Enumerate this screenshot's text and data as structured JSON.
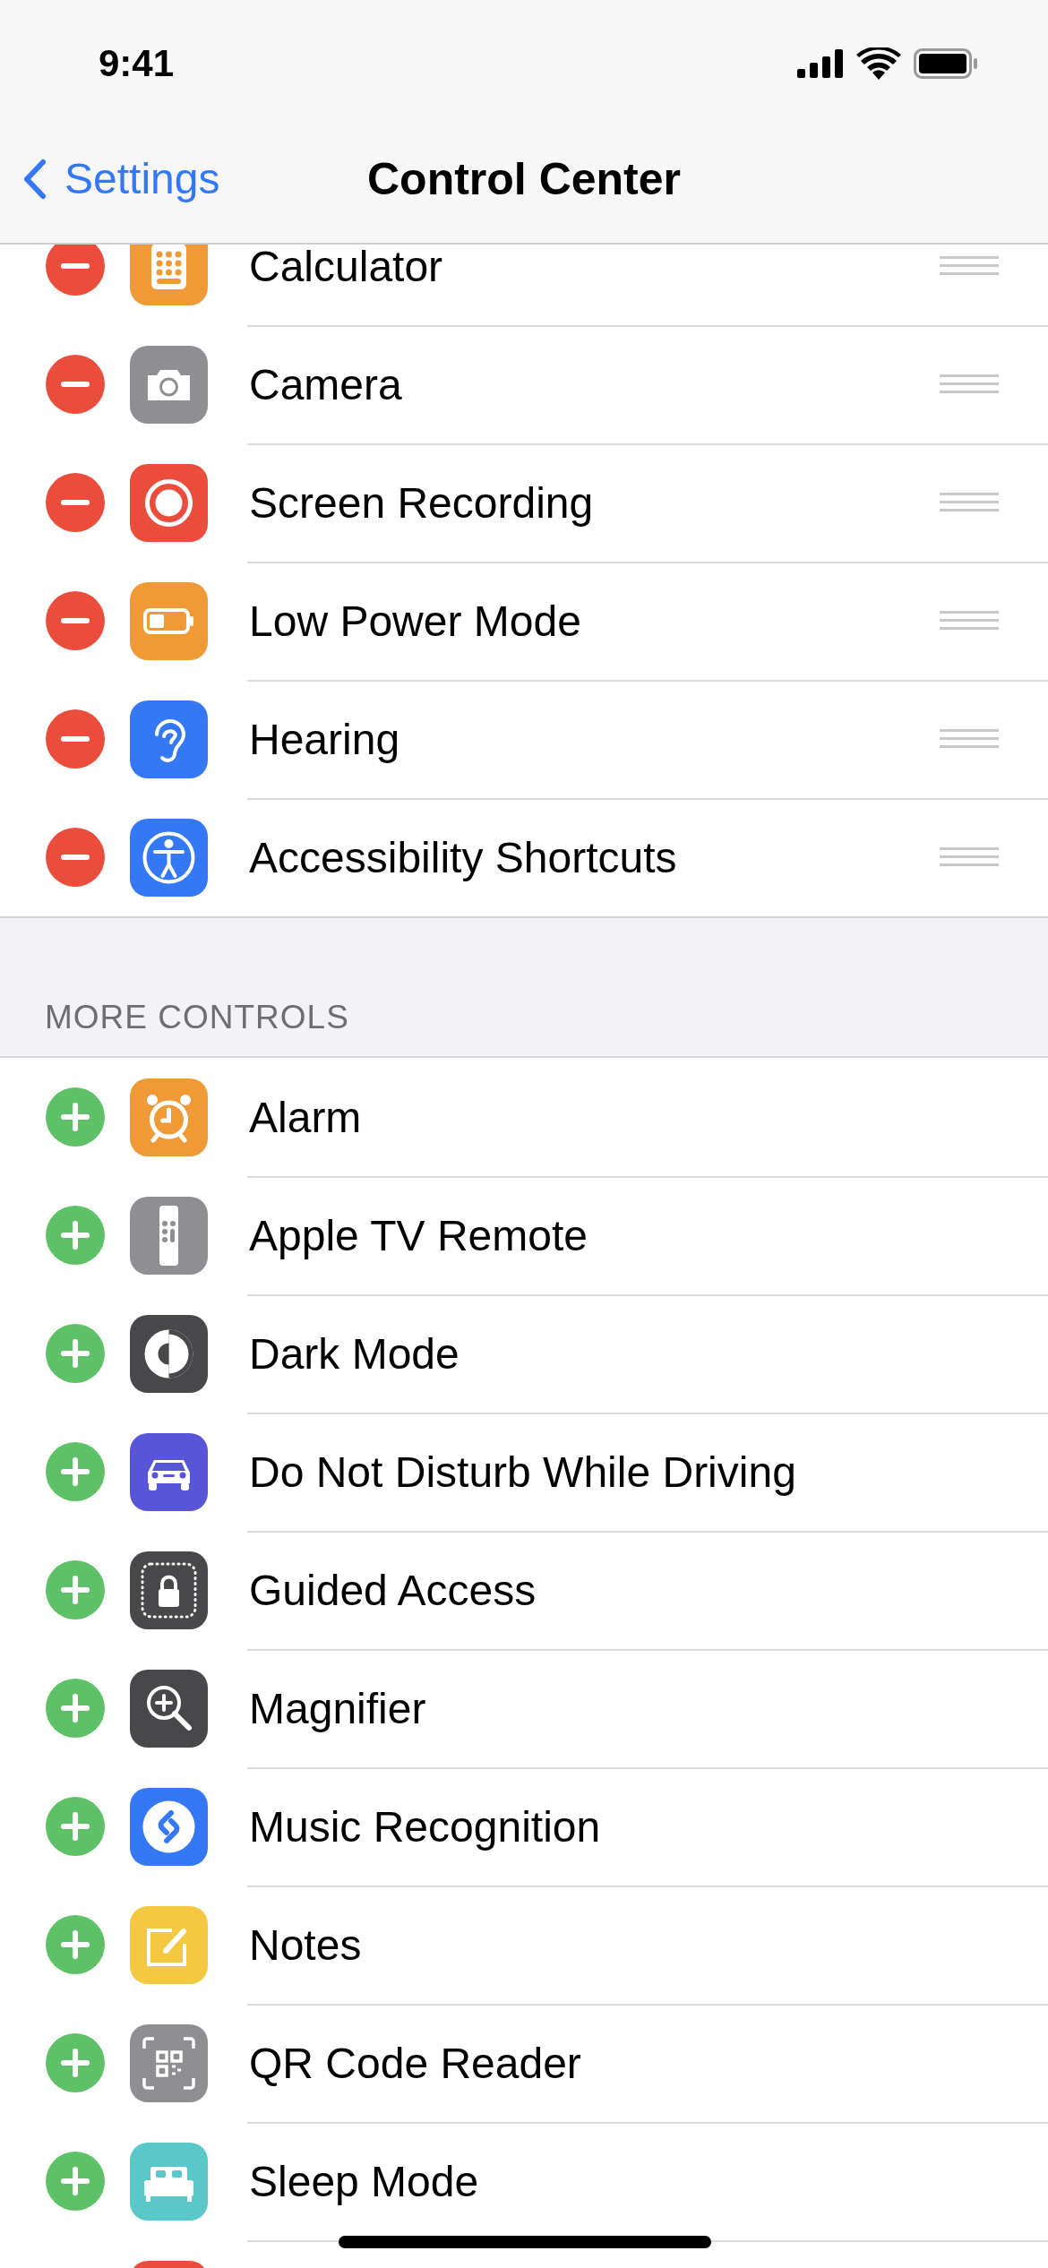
{
  "status_bar": {
    "time": "9:41"
  },
  "nav": {
    "back_label": "Settings",
    "title": "Control Center"
  },
  "included": [
    {
      "label": "Calculator",
      "kind": "calculator"
    },
    {
      "label": "Camera",
      "kind": "camera"
    },
    {
      "label": "Screen Recording",
      "kind": "record"
    },
    {
      "label": "Low Power Mode",
      "kind": "battery"
    },
    {
      "label": "Hearing",
      "kind": "ear"
    },
    {
      "label": "Accessibility Shortcuts",
      "kind": "accessibility"
    }
  ],
  "more_controls": {
    "header": "MORE CONTROLS",
    "items": [
      {
        "label": "Alarm",
        "kind": "alarm"
      },
      {
        "label": "Apple TV Remote",
        "kind": "remote"
      },
      {
        "label": "Dark Mode",
        "kind": "darkmode"
      },
      {
        "label": "Do Not Disturb While Driving",
        "kind": "car"
      },
      {
        "label": "Guided Access",
        "kind": "lock"
      },
      {
        "label": "Magnifier",
        "kind": "magnifier"
      },
      {
        "label": "Music Recognition",
        "kind": "shazam"
      },
      {
        "label": "Notes",
        "kind": "notes"
      },
      {
        "label": "QR Code Reader",
        "kind": "qr"
      },
      {
        "label": "Sleep Mode",
        "kind": "bed"
      },
      {
        "kind": "unknown"
      }
    ]
  }
}
